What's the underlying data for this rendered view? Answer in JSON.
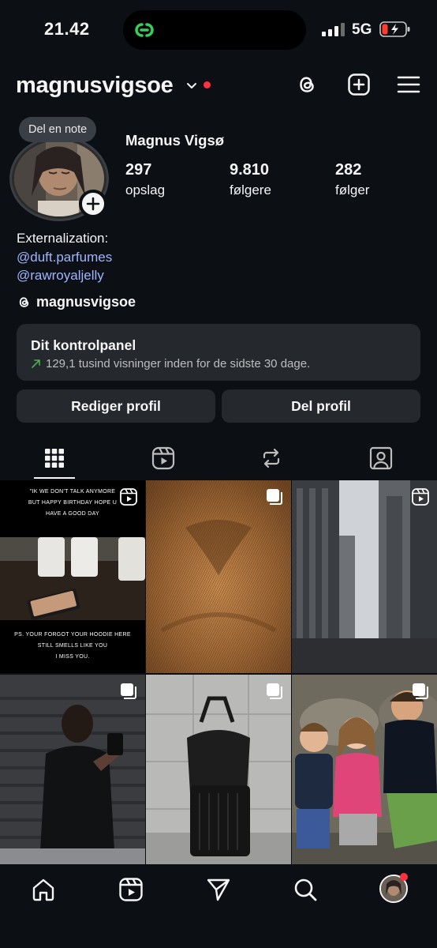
{
  "status_bar": {
    "time": "21.42",
    "network": "5G"
  },
  "header": {
    "username": "magnusvigsoe"
  },
  "profile": {
    "note_bubble": "Del en note",
    "full_name": "Magnus Vigsø",
    "stats": [
      {
        "value": "297",
        "label": "opslag"
      },
      {
        "value": "9.810",
        "label": "følgere"
      },
      {
        "value": "282",
        "label": "følger"
      }
    ],
    "bio_lines": [
      "Externalization:"
    ],
    "bio_links": [
      "@duft.parfumes",
      "@rawroyaljelly"
    ],
    "threads_handle": "magnusvigsoe"
  },
  "dashboard": {
    "title": "Dit kontrolpanel",
    "subtitle": "129,1 tusind visninger inden for de sidste 30 dage."
  },
  "actions": {
    "edit_profile": "Rediger profil",
    "share_profile": "Del profil"
  },
  "posts": {
    "p1_top_lines": [
      "\"IK WE DON'T TALK ANYMORE",
      "BUT HAPPY BIRTHDAY HOPE U",
      "HAVE A GOOD DAY"
    ],
    "p1_bottom_lines": [
      "PS. YOUR FORGOT YOUR HOODIE HERE",
      "STILL SMELLS LIKE YOU",
      "I MISS YOU."
    ]
  },
  "icons": {
    "threads": "threads-icon",
    "new_post": "plus-square-icon",
    "menu": "hamburger-icon",
    "grid_tab": "grid-icon",
    "reels_tab": "reels-icon",
    "reposts_tab": "repost-icon",
    "tagged_tab": "tagged-icon",
    "home": "home-icon",
    "reels": "reels-icon",
    "send": "send-icon",
    "search": "search-icon"
  },
  "colors": {
    "background": "#0c1014",
    "surface": "#25292e",
    "link": "#9fb4ff",
    "notification": "#ff3040",
    "trend": "#4caf50"
  }
}
